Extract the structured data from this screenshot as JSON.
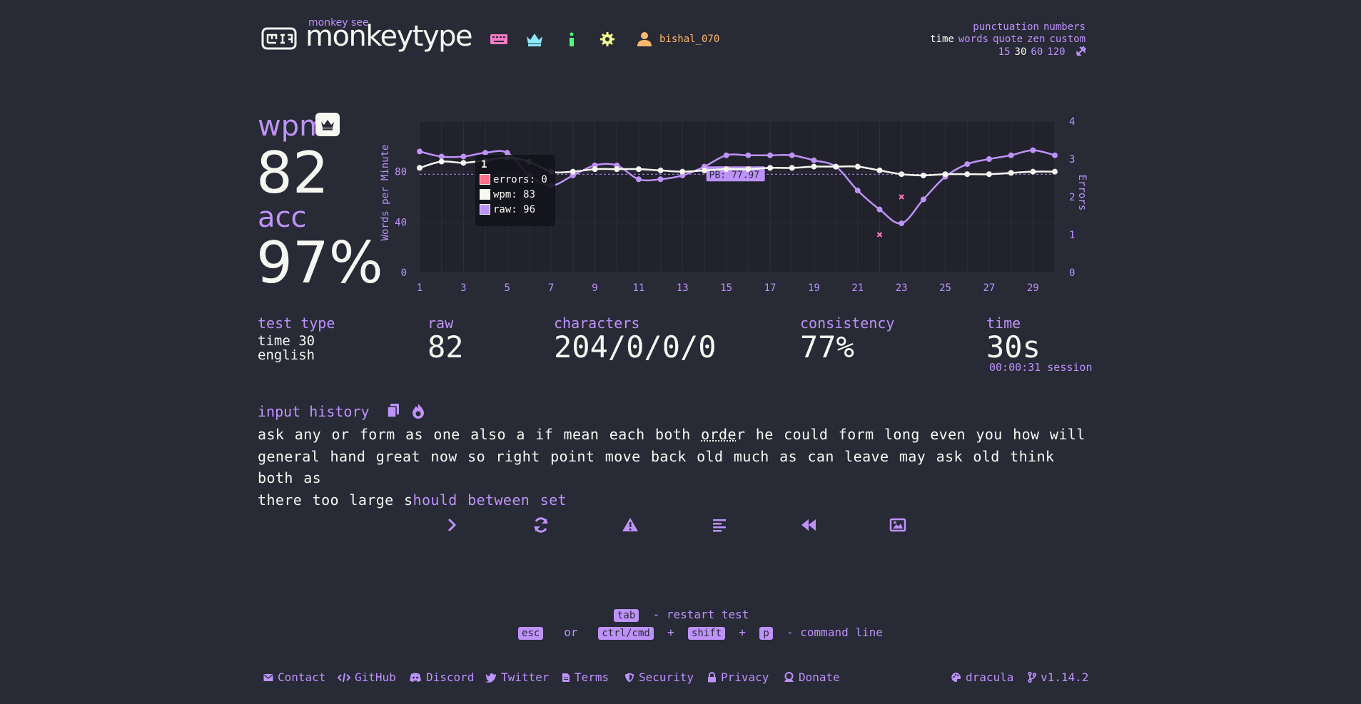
{
  "header": {
    "logo_small": "monkey see",
    "logo": "monkeytype",
    "username": "bishal_070",
    "config": {
      "line1": [
        "punctuation",
        "numbers"
      ],
      "line2": [
        "time",
        "words",
        "quote",
        "zen",
        "custom"
      ],
      "line2_active": "time",
      "line3": [
        "15",
        "30",
        "60",
        "120"
      ],
      "line3_active": "30"
    }
  },
  "result": {
    "wpm_label": "wpm",
    "wpm": "82",
    "acc_label": "acc",
    "acc": "97%",
    "test_type_label": "test type",
    "test_type_line1": "time 30",
    "test_type_line2": "english",
    "raw_label": "raw",
    "raw": "82",
    "characters_label": "characters",
    "characters": "204/0/0/0",
    "consistency_label": "consistency",
    "consistency": "77%",
    "time_label": "time",
    "time": "30s",
    "session": "00:00:31 session"
  },
  "chart_data": {
    "type": "line",
    "x": [
      1,
      2,
      3,
      4,
      5,
      6,
      7,
      8,
      9,
      10,
      11,
      12,
      13,
      14,
      15,
      16,
      17,
      18,
      19,
      20,
      21,
      22,
      23,
      24,
      25,
      26,
      27,
      28,
      29,
      30
    ],
    "x_ticks": [
      "1",
      "3",
      "5",
      "7",
      "9",
      "11",
      "13",
      "15",
      "17",
      "19",
      "21",
      "23",
      "25",
      "27",
      "29"
    ],
    "ylabel": "Words per Minute",
    "y_ticks": [
      "0",
      "40",
      "80"
    ],
    "ylim": [
      0,
      120
    ],
    "y2label": "Errors",
    "y2_ticks": [
      "0",
      "1",
      "2",
      "3",
      "4"
    ],
    "y2lim": [
      0,
      4
    ],
    "series": [
      {
        "name": "wpm",
        "color": "#f8f8f2",
        "values": [
          83,
          88,
          87,
          89,
          91,
          88,
          80,
          80,
          82,
          82,
          82,
          81,
          80,
          81,
          82,
          82,
          83,
          83,
          84,
          84,
          84,
          81,
          78,
          77,
          78,
          78,
          78,
          79,
          80,
          80
        ]
      },
      {
        "name": "raw",
        "color": "#bd93f9",
        "values": [
          96,
          92,
          92,
          95,
          95,
          77,
          69,
          77,
          85,
          85,
          74,
          74,
          77,
          84,
          93,
          93,
          93,
          93,
          89,
          84,
          65,
          50,
          39,
          58,
          76,
          86,
          90,
          93,
          97,
          93
        ]
      },
      {
        "name": "errors",
        "color": "#ff79c6",
        "points": [
          [
            22,
            1
          ],
          [
            23,
            2
          ]
        ]
      }
    ],
    "pb_label": "PB: 77.97",
    "pb_value": 77.97,
    "tooltip": {
      "title": "1",
      "rows": [
        {
          "label": "errors: 0",
          "color": "#ff6e8a"
        },
        {
          "label": "wpm: 83",
          "color": "#f8f8f2"
        },
        {
          "label": "raw: 96",
          "color": "#bd93f9"
        }
      ]
    },
    "grid": true
  },
  "history": {
    "label": "input history",
    "line1a": "ask any or form as one also a if mean each both ",
    "line1_err": "orde",
    "line1b": "r he could form long even you how will",
    "line2": "general hand great now so right point move back old much as can leave may ask old think both as",
    "line3_typed": "there too large s",
    "line3_rest": "hould between set"
  },
  "hints": {
    "tab": "tab",
    "restart": "- restart test",
    "esc": "esc",
    "or": "or",
    "ctrl": "ctrl/cmd",
    "plus": "+",
    "shift": "shift",
    "p": "p",
    "command": "- command line"
  },
  "footer": {
    "contact": "Contact",
    "github": "GitHub",
    "discord": "Discord",
    "twitter": "Twitter",
    "terms": "Terms",
    "security": "Security",
    "privacy": "Privacy",
    "donate": "Donate",
    "theme": "dracula",
    "version": "v1.14.2"
  }
}
